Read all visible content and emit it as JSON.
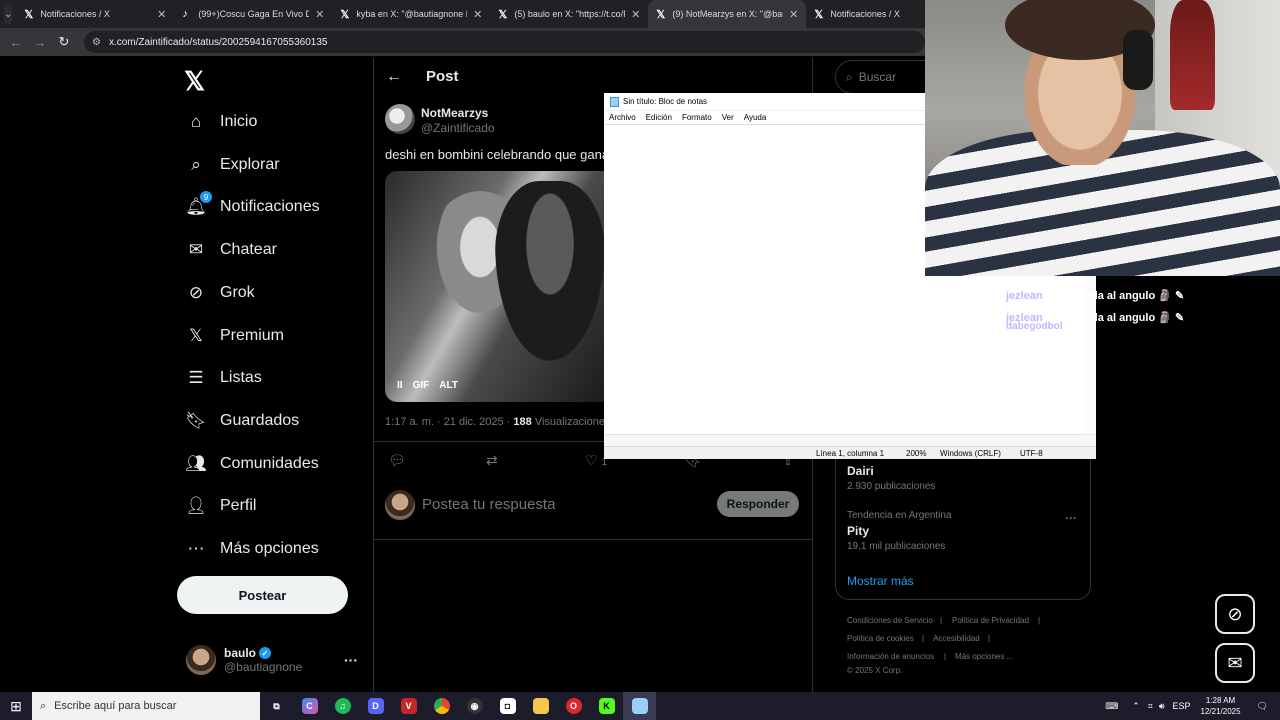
{
  "browser": {
    "tabs": [
      {
        "label": "Notificaciones / X",
        "favicon": "x-icon"
      },
      {
        "label": "(99+)Coscu Gaga En Vivo Desd",
        "favicon": "tiktok-icon"
      },
      {
        "label": "kyba en X: \"@bautiagnone NO",
        "favicon": "x-icon"
      },
      {
        "label": "(5) baulo en X: \"https://t.co/FT",
        "favicon": "x-icon"
      },
      {
        "label": "(9) NotMearzys en X: \"@bautia",
        "favicon": "x-icon",
        "active": true
      },
      {
        "label": "Notificaciones / X",
        "favicon": "x-icon"
      }
    ],
    "url": "x.com/Zaintificado/status/2002594167055360135"
  },
  "x_nav": {
    "items": [
      {
        "label": "Inicio",
        "icon": "home-icon"
      },
      {
        "label": "Explorar",
        "icon": "search-icon"
      },
      {
        "label": "Notificaciones",
        "icon": "bell-icon",
        "badge": "9"
      },
      {
        "label": "Chatear",
        "icon": "mail-icon"
      },
      {
        "label": "Grok",
        "icon": "grok-icon"
      },
      {
        "label": "Premium",
        "icon": "x-icon"
      },
      {
        "label": "Listas",
        "icon": "list-icon"
      },
      {
        "label": "Guardados",
        "icon": "bookmark-icon"
      },
      {
        "label": "Comunidades",
        "icon": "people-icon"
      },
      {
        "label": "Perfil",
        "icon": "person-icon"
      },
      {
        "label": "Más opciones",
        "icon": "more-circle-icon"
      }
    ],
    "post_button": "Postear",
    "user": {
      "name": "baulo",
      "handle": "@bautiagnone"
    }
  },
  "post": {
    "header": "Post",
    "author_name": "NotMearzys",
    "author_handle": "@Zaintificado",
    "text": "deshi en bombini celebrando que gana",
    "media_controls": {
      "pause": "II",
      "gif": "GIF",
      "alt": "ALT"
    },
    "time": "1:17 a. m. · 21 dic. 2025 · ",
    "views_count": "188",
    "views_label": " Visualizaciones",
    "like_count": "1",
    "reply_placeholder": "Postea tu respuesta",
    "reply_button": "Responder"
  },
  "right": {
    "search_placeholder": "Buscar",
    "trends": [
      {
        "name": "Dairi",
        "posts": "2.930 publicaciones"
      },
      {
        "context": "Tendencia en Argentina",
        "name": "Pity",
        "posts": "19,1 mil publicaciones"
      }
    ],
    "show_more": "Mostrar más",
    "footer": [
      "Condiciones de Servicio",
      "Política de Privacidad",
      "Política de cookies",
      "Accesibilidad",
      "Información de anuncios",
      "Más opciones ...",
      "© 2025 X Corp."
    ]
  },
  "notepad": {
    "title": "Sin título: Bloc de notas",
    "menu": [
      "Archivo",
      "Edición",
      "Formato",
      "Ver",
      "Ayuda"
    ],
    "status": {
      "position": "Línea 1, columna 1",
      "zoom": "200%",
      "eol": "Windows (CRLF)",
      "encoding": "UTF-8"
    }
  },
  "stream_chat": [
    {
      "user": "jezlean",
      "msg": ": a buscarla al angulo"
    },
    {
      "user": "jezlean",
      "msg": ": a buscarla al angulo"
    },
    {
      "user": "dabegodbol",
      "msg": ":"
    }
  ],
  "taskbar": {
    "search_placeholder": "Escribe aquí para buscar",
    "lang": "ESP",
    "time": "1:28 AM",
    "date": "12/21/2025"
  }
}
